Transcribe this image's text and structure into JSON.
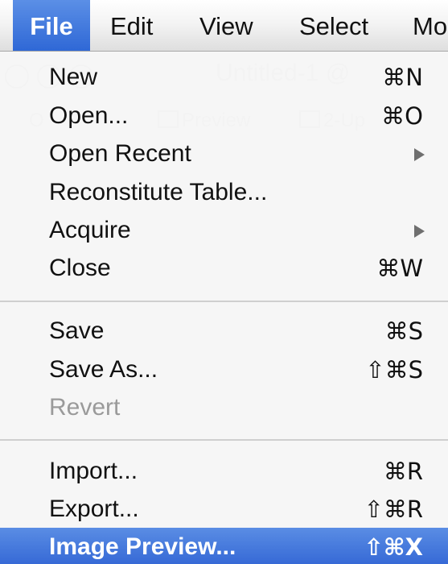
{
  "menubar": {
    "items": [
      {
        "label": "File",
        "active": true
      },
      {
        "label": "Edit"
      },
      {
        "label": "View"
      },
      {
        "label": "Select"
      },
      {
        "label": "Mo"
      }
    ]
  },
  "background_window": {
    "title": "Untitled-1 @ ",
    "tabs": [
      "O",
      "Preview",
      "2-Up"
    ]
  },
  "file_menu": {
    "items": [
      {
        "label": "New",
        "shortcut": "⌘N"
      },
      {
        "label": "Open...",
        "shortcut": "⌘O"
      },
      {
        "label": "Open Recent",
        "submenu": true
      },
      {
        "label": "Reconstitute Table..."
      },
      {
        "label": "Acquire",
        "submenu": true
      },
      {
        "label": "Close",
        "shortcut": "⌘W"
      },
      {
        "label": "Save",
        "shortcut": "⌘S"
      },
      {
        "label": "Save As...",
        "shortcut": "⇧⌘S"
      },
      {
        "label": "Revert",
        "disabled": true
      },
      {
        "label": "Import...",
        "shortcut": "⌘R"
      },
      {
        "label": "Export...",
        "shortcut": "⇧⌘R"
      },
      {
        "label": "Image Preview...",
        "shortcut": "⇧⌘X",
        "selected": true
      }
    ]
  },
  "colors": {
    "highlight": "#3f74dc",
    "menu_background": "#f6f6f6",
    "disabled_text": "#9a9a9a",
    "separator": "#cfcfcf"
  },
  "icons": {
    "submenu_arrow": "triangle-right-icon"
  }
}
